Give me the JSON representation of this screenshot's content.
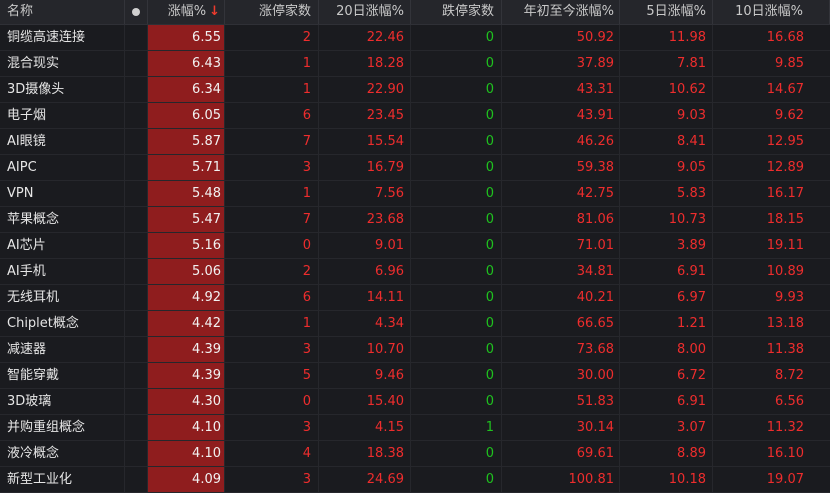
{
  "headers": {
    "name": "名称",
    "pct": "涨幅%",
    "limit_up": "涨停家数",
    "d20": "20日涨幅%",
    "limit_down": "跌停家数",
    "ytd": "年初至今涨幅%",
    "d5": "5日涨幅%",
    "d10": "10日涨幅%"
  },
  "sort_arrow": "↓",
  "colors": {
    "up": "#ee2d2d",
    "down": "#1fc21f",
    "pct_bg": "#8f1d1e"
  },
  "rows": [
    {
      "name": "铜缆高速连接",
      "pct": "6.55",
      "limit_up": "2",
      "d20": "22.46",
      "limit_down": "0",
      "ytd": "50.92",
      "d5": "11.98",
      "d10": "16.68"
    },
    {
      "name": "混合现实",
      "pct": "6.43",
      "limit_up": "1",
      "d20": "18.28",
      "limit_down": "0",
      "ytd": "37.89",
      "d5": "7.81",
      "d10": "9.85"
    },
    {
      "name": "3D摄像头",
      "pct": "6.34",
      "limit_up": "1",
      "d20": "22.90",
      "limit_down": "0",
      "ytd": "43.31",
      "d5": "10.62",
      "d10": "14.67"
    },
    {
      "name": "电子烟",
      "pct": "6.05",
      "limit_up": "6",
      "d20": "23.45",
      "limit_down": "0",
      "ytd": "43.91",
      "d5": "9.03",
      "d10": "9.62"
    },
    {
      "name": "AI眼镜",
      "pct": "5.87",
      "limit_up": "7",
      "d20": "15.54",
      "limit_down": "0",
      "ytd": "46.26",
      "d5": "8.41",
      "d10": "12.95"
    },
    {
      "name": "AIPC",
      "pct": "5.71",
      "limit_up": "3",
      "d20": "16.79",
      "limit_down": "0",
      "ytd": "59.38",
      "d5": "9.05",
      "d10": "12.89"
    },
    {
      "name": "VPN",
      "pct": "5.48",
      "limit_up": "1",
      "d20": "7.56",
      "limit_down": "0",
      "ytd": "42.75",
      "d5": "5.83",
      "d10": "16.17"
    },
    {
      "name": "苹果概念",
      "pct": "5.47",
      "limit_up": "7",
      "d20": "23.68",
      "limit_down": "0",
      "ytd": "81.06",
      "d5": "10.73",
      "d10": "18.15"
    },
    {
      "name": "AI芯片",
      "pct": "5.16",
      "limit_up": "0",
      "d20": "9.01",
      "limit_down": "0",
      "ytd": "71.01",
      "d5": "3.89",
      "d10": "19.11"
    },
    {
      "name": "AI手机",
      "pct": "5.06",
      "limit_up": "2",
      "d20": "6.96",
      "limit_down": "0",
      "ytd": "34.81",
      "d5": "6.91",
      "d10": "10.89"
    },
    {
      "name": "无线耳机",
      "pct": "4.92",
      "limit_up": "6",
      "d20": "14.11",
      "limit_down": "0",
      "ytd": "40.21",
      "d5": "6.97",
      "d10": "9.93"
    },
    {
      "name": "Chiplet概念",
      "pct": "4.42",
      "limit_up": "1",
      "d20": "4.34",
      "limit_down": "0",
      "ytd": "66.65",
      "d5": "1.21",
      "d10": "13.18"
    },
    {
      "name": "减速器",
      "pct": "4.39",
      "limit_up": "3",
      "d20": "10.70",
      "limit_down": "0",
      "ytd": "73.68",
      "d5": "8.00",
      "d10": "11.38"
    },
    {
      "name": "智能穿戴",
      "pct": "4.39",
      "limit_up": "5",
      "d20": "9.46",
      "limit_down": "0",
      "ytd": "30.00",
      "d5": "6.72",
      "d10": "8.72"
    },
    {
      "name": "3D玻璃",
      "pct": "4.30",
      "limit_up": "0",
      "d20": "15.40",
      "limit_down": "0",
      "ytd": "51.83",
      "d5": "6.91",
      "d10": "6.56"
    },
    {
      "name": "并购重组概念",
      "pct": "4.10",
      "limit_up": "3",
      "d20": "4.15",
      "limit_down": "1",
      "ytd": "30.14",
      "d5": "3.07",
      "d10": "11.32"
    },
    {
      "name": "液冷概念",
      "pct": "4.10",
      "limit_up": "4",
      "d20": "18.38",
      "limit_down": "0",
      "ytd": "69.61",
      "d5": "8.89",
      "d10": "16.10"
    },
    {
      "name": "新型工业化",
      "pct": "4.09",
      "limit_up": "3",
      "d20": "24.69",
      "limit_down": "0",
      "ytd": "100.81",
      "d5": "10.18",
      "d10": "19.07"
    }
  ]
}
